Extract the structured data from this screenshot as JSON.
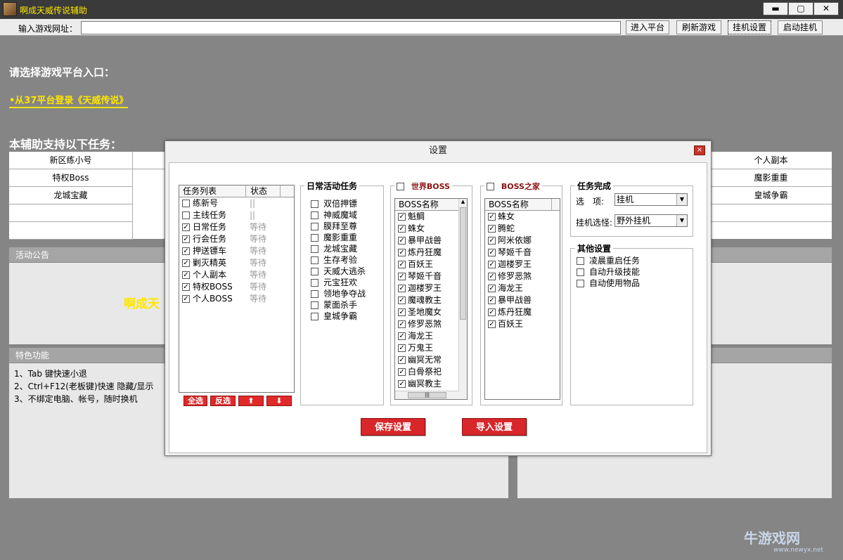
{
  "app": {
    "title": "啊成天威传说辅助",
    "win_min": "▬",
    "win_max": "▢",
    "win_close": "✕"
  },
  "toolbar": {
    "url_label": "输入游戏网址：",
    "url_value": "",
    "buttons": [
      "进入平台",
      "刷新游戏",
      "挂机设置",
      "启动挂机"
    ]
  },
  "main": {
    "choose_heading": "请选择游戏平台入口：",
    "platform_link": "•从37平台登录《天威传说》",
    "tasks_heading": "本辅助支持以下任务：",
    "task_rows": [
      [
        "新区练小号",
        "",
        "",
        "",
        "个人副本"
      ],
      [
        "特权Boss",
        "",
        "",
        "",
        "魔影重重"
      ],
      [
        "龙城宝藏",
        "",
        "",
        "",
        "皇城争霸"
      ],
      [
        "",
        "",
        "",
        "",
        ""
      ],
      [
        "",
        "",
        "",
        "",
        ""
      ]
    ],
    "announce_title": "活动公告",
    "announce_text": "啊成天",
    "features_title": "特色功能",
    "features": [
      "1、Tab 键快速小退",
      "2、Ctrl+F12(老板键)快速 隐藏/显示",
      "3、不绑定电脑、帐号，随时换机"
    ]
  },
  "dialog": {
    "title": "设置",
    "close": "×",
    "task_list": {
      "col_task": "任务列表",
      "col_status": "状态",
      "rows": [
        {
          "name": "练新号",
          "checked": false,
          "status": "||"
        },
        {
          "name": "主线任务",
          "checked": false,
          "status": "||"
        },
        {
          "name": "日常任务",
          "checked": true,
          "status": "等待"
        },
        {
          "name": "行会任务",
          "checked": true,
          "status": "等待"
        },
        {
          "name": "押送镖车",
          "checked": true,
          "status": "等待"
        },
        {
          "name": "剿灭精英",
          "checked": true,
          "status": "等待"
        },
        {
          "name": "个人副本",
          "checked": true,
          "status": "等待"
        },
        {
          "name": "特权BOSS",
          "checked": true,
          "status": "等待"
        },
        {
          "name": "个人BOSS",
          "checked": true,
          "status": "等待"
        }
      ],
      "btn_all": "全选",
      "btn_invert": "反选",
      "btn_up": "⬆",
      "btn_down": "⬇"
    },
    "daily": {
      "title": "日常活动任务",
      "items": [
        "双倍押镖",
        "神威魔域",
        "膜拜至尊",
        "魔影重重",
        "龙城宝藏",
        "生存考验",
        "天威大逃杀",
        "元宝狂欢",
        "领地争夺战",
        "蒙面杀手",
        "皇城争霸"
      ]
    },
    "world_boss": {
      "title": "世界BOSS",
      "col": "BOSS名称",
      "items": [
        "魁鲷",
        "蛛女",
        "暴甲战兽",
        "炼丹狂魔",
        "百妖王",
        "琴姬千音",
        "迦楼罗王",
        "魔魂教主",
        "圣地魔女",
        "修罗恶煞",
        "海龙王",
        "万鬼王",
        "幽冥无常",
        "白骨祭祀",
        "幽冥教主"
      ],
      "hscroll": "|||"
    },
    "boss_home": {
      "title": "BOSS之家",
      "col": "BOSS名称",
      "items": [
        "蛛女",
        "腾蛇",
        "阿米依娜",
        "琴姬千音",
        "迦楼罗王",
        "修罗恶煞",
        "海龙王",
        "暴甲战兽",
        "炼丹狂魔",
        "百妖王"
      ]
    },
    "complete": {
      "title": "任务完成",
      "option_label": "选　项:",
      "option_value": "挂机",
      "mob_label": "挂机选怪:",
      "mob_value": "野外挂机"
    },
    "other": {
      "title": "其他设置",
      "items": [
        "凌晨重启任务",
        "自动升级技能",
        "自动使用物品"
      ]
    },
    "save_btn": "保存设置",
    "import_btn": "导入设置"
  },
  "watermark": {
    "text": "牛游戏网",
    "url": "www.newyx.net"
  }
}
